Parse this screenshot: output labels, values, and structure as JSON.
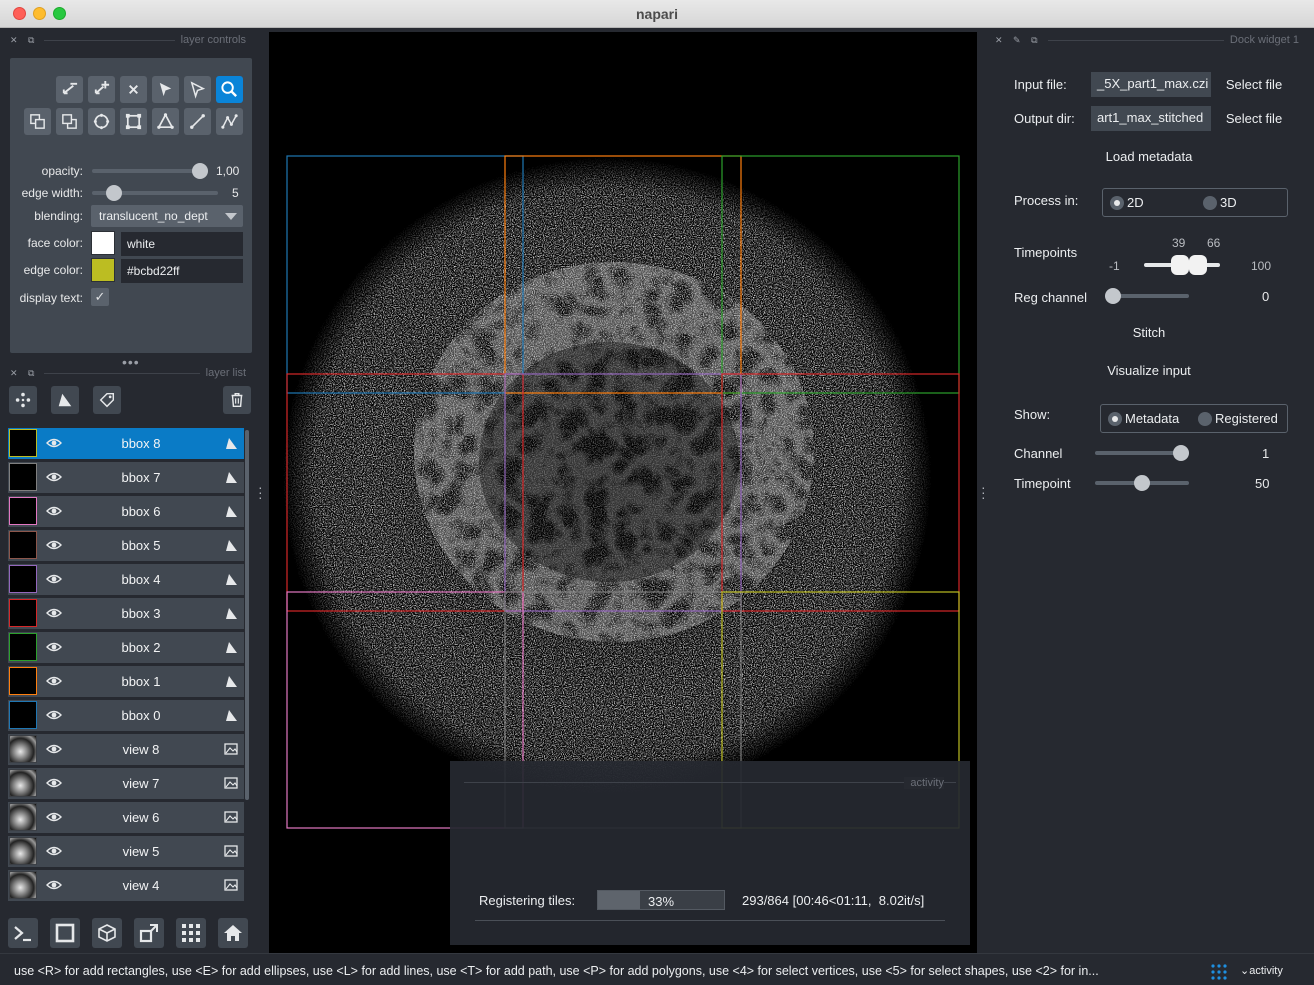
{
  "window": {
    "title": "napari"
  },
  "left_dock": {
    "controls_title": "layer controls",
    "list_title": "layer list"
  },
  "controls": {
    "opacity": {
      "label": "opacity:",
      "value": "1,00",
      "fraction": 1.0
    },
    "edge_width": {
      "label": "edge width:",
      "value": "5",
      "fraction": 0.15
    },
    "blending": {
      "label": "blending:",
      "value": "translucent_no_dept"
    },
    "face_color": {
      "label": "face color:",
      "value": "white",
      "swatch": "#ffffff"
    },
    "edge_color": {
      "label": "edge color:",
      "value": "#bcbd22ff",
      "swatch": "#bcbd22"
    },
    "display_text": {
      "label": "display text:",
      "checked": true
    }
  },
  "layers": [
    {
      "name": "bbox 8",
      "type": "shapes",
      "color": "#bcbd22",
      "selected": true
    },
    {
      "name": "bbox 7",
      "type": "shapes",
      "color": "#7f7f7f",
      "selected": false
    },
    {
      "name": "bbox 6",
      "type": "shapes",
      "color": "#e377c2",
      "selected": false
    },
    {
      "name": "bbox 5",
      "type": "shapes",
      "color": "#8c564b",
      "selected": false
    },
    {
      "name": "bbox 4",
      "type": "shapes",
      "color": "#9467bd",
      "selected": false
    },
    {
      "name": "bbox 3",
      "type": "shapes",
      "color": "#d62728",
      "selected": false
    },
    {
      "name": "bbox 2",
      "type": "shapes",
      "color": "#2ca02c",
      "selected": false
    },
    {
      "name": "bbox 1",
      "type": "shapes",
      "color": "#ff7f0e",
      "selected": false
    },
    {
      "name": "bbox 0",
      "type": "shapes",
      "color": "#1f77b4",
      "selected": false
    },
    {
      "name": "view 8",
      "type": "image",
      "selected": false
    },
    {
      "name": "view 7",
      "type": "image",
      "selected": false
    },
    {
      "name": "view 6",
      "type": "image",
      "selected": false
    },
    {
      "name": "view 5",
      "type": "image",
      "selected": false
    },
    {
      "name": "view 4",
      "type": "image",
      "selected": false
    }
  ],
  "dock_widget": {
    "title": "Dock widget 1",
    "input_file": {
      "label": "Input file:",
      "value": "_5X_part1_max.czi",
      "button": "Select file"
    },
    "output_dir": {
      "label": "Output dir:",
      "value": "art1_max_stitched",
      "button": "Select file"
    },
    "load_metadata": "Load metadata",
    "process_in": {
      "label": "Process in:",
      "options": [
        "2D",
        "3D"
      ],
      "selected": "2D"
    },
    "timepoints": {
      "label": "Timepoints",
      "min": "-1",
      "max": "100",
      "low": "39",
      "high": "66"
    },
    "reg_channel": {
      "label": "Reg channel",
      "value": "0"
    },
    "stitch": "Stitch",
    "visualize_input": "Visualize input",
    "show": {
      "label": "Show:",
      "options": [
        "Metadata",
        "Registered"
      ],
      "selected": "Metadata"
    },
    "channel": {
      "label": "Channel",
      "value": "1"
    },
    "timepoint": {
      "label": "Timepoint",
      "value": "50"
    }
  },
  "activity": {
    "title": "activity",
    "task": "Registering tiles:",
    "percent": "33%",
    "fraction": 0.33,
    "detail": "293/864 [00:46<01:11,  8.02it/s]"
  },
  "status": {
    "message": "use <R> for add rectangles, use <E> for add ellipses, use <L> for add lines, use <T> for add path, use <P> for add polygons, use <4> for select vertices, use <5> for select shapes, use <2> for in...",
    "activity_toggle": "activity"
  },
  "colors": {
    "accent": "#0a84d8",
    "panel": "#262930",
    "control": "#414851"
  }
}
